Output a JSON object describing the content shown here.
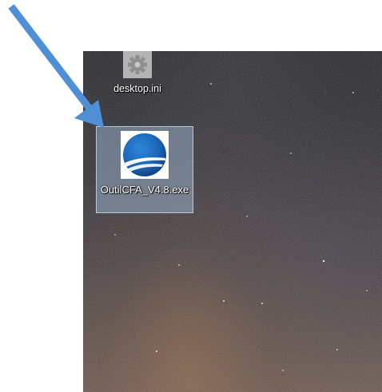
{
  "desktop": {
    "icons": [
      {
        "label": "desktop.ini",
        "icon": "settings-file-icon",
        "selected": false
      },
      {
        "label": "OutilCFA_V4.8.exe",
        "icon": "app-logo-icon",
        "selected": true
      }
    ]
  },
  "annotation": {
    "icon": "arrow-pointer-icon",
    "color": "#4f8fd6"
  },
  "colors": {
    "selection_fill": "#adceec",
    "label_text": "#ffffff",
    "app_logo_blue": "#1c66b8"
  }
}
